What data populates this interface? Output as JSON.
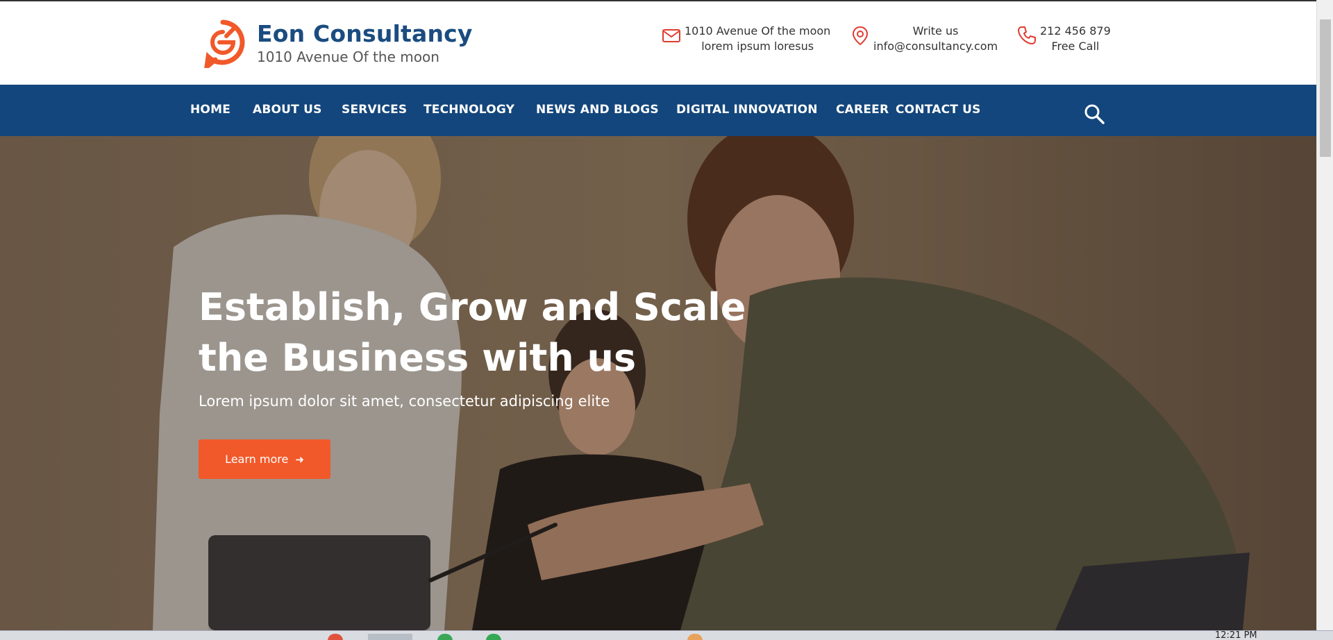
{
  "brand": {
    "name": "Eon Consultancy",
    "tagline": "1010 Avenue Of the moon",
    "accent_color": "#f1592a",
    "primary_color": "#13467c"
  },
  "contacts": [
    {
      "icon": "envelope-icon",
      "line1": "1010 Avenue Of the moon",
      "line2": "lorem ipsum loresus"
    },
    {
      "icon": "map-pin-icon",
      "line1": "Write us",
      "line2": "info@consultancy.com"
    },
    {
      "icon": "phone-icon",
      "line1": "212 456 879",
      "line2": "Free Call"
    }
  ],
  "nav": {
    "items": [
      {
        "label": "HOME"
      },
      {
        "label": "ABOUT US"
      },
      {
        "label": "SERVICES"
      },
      {
        "label": "TECHNOLOGY"
      },
      {
        "label": "NEWS AND BLOGS"
      },
      {
        "label": "DIGITAL INNOVATION"
      },
      {
        "label": "CAREER"
      },
      {
        "label": "CONTACT US"
      }
    ],
    "search_icon": "search-icon"
  },
  "hero": {
    "title_line1": "Establish, Grow and Scale",
    "title_line2": "the Business with us",
    "subtitle": "Lorem ipsum dolor sit amet, consectetur adipiscing elite",
    "cta_label": "Learn more",
    "cta_icon": "arrow-right-icon"
  },
  "taskbar": {
    "clock": "12:21 PM"
  }
}
